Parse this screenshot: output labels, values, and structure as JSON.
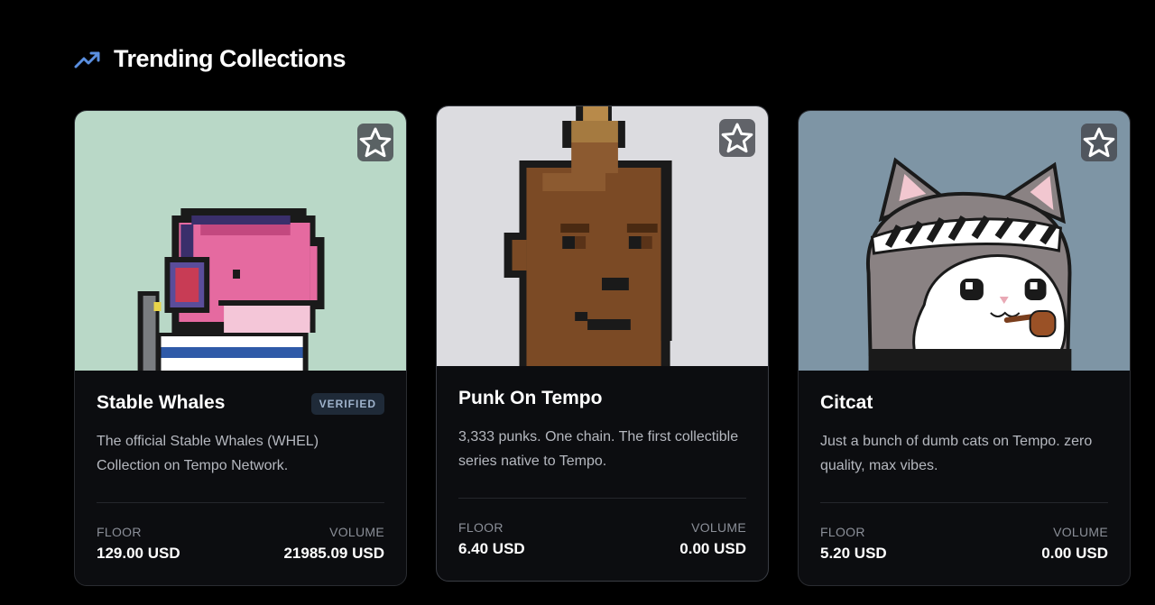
{
  "header": {
    "title": "Trending Collections",
    "icon": "trending-up-icon",
    "icon_color": "#5a8fe0"
  },
  "cards": [
    {
      "name": "Stable Whales",
      "badge": "VERIFIED",
      "description": "The official Stable Whales (WHEL) Collection on Tempo Network.",
      "floor_label": "FLOOR",
      "floor": "129.00 USD",
      "volume_label": "VOLUME",
      "volume": "21985.09 USD",
      "art_bg": "#b9d8c7",
      "icon": "star-icon"
    },
    {
      "name": "Punk On Tempo",
      "description": "3,333 punks. One chain. The first collectible series native to Tempo.",
      "floor_label": "FLOOR",
      "floor": "6.40 USD",
      "volume_label": "VOLUME",
      "volume": "0.00 USD",
      "art_bg": "#dcdce0",
      "icon": "star-icon"
    },
    {
      "name": "Citcat",
      "description": "Just a bunch of dumb cats on Tempo. zero quality, max vibes.",
      "floor_label": "FLOOR",
      "floor": "5.20 USD",
      "volume_label": "VOLUME",
      "volume": "0.00 USD",
      "art_bg": "#7e95a5",
      "icon": "star-icon"
    }
  ]
}
